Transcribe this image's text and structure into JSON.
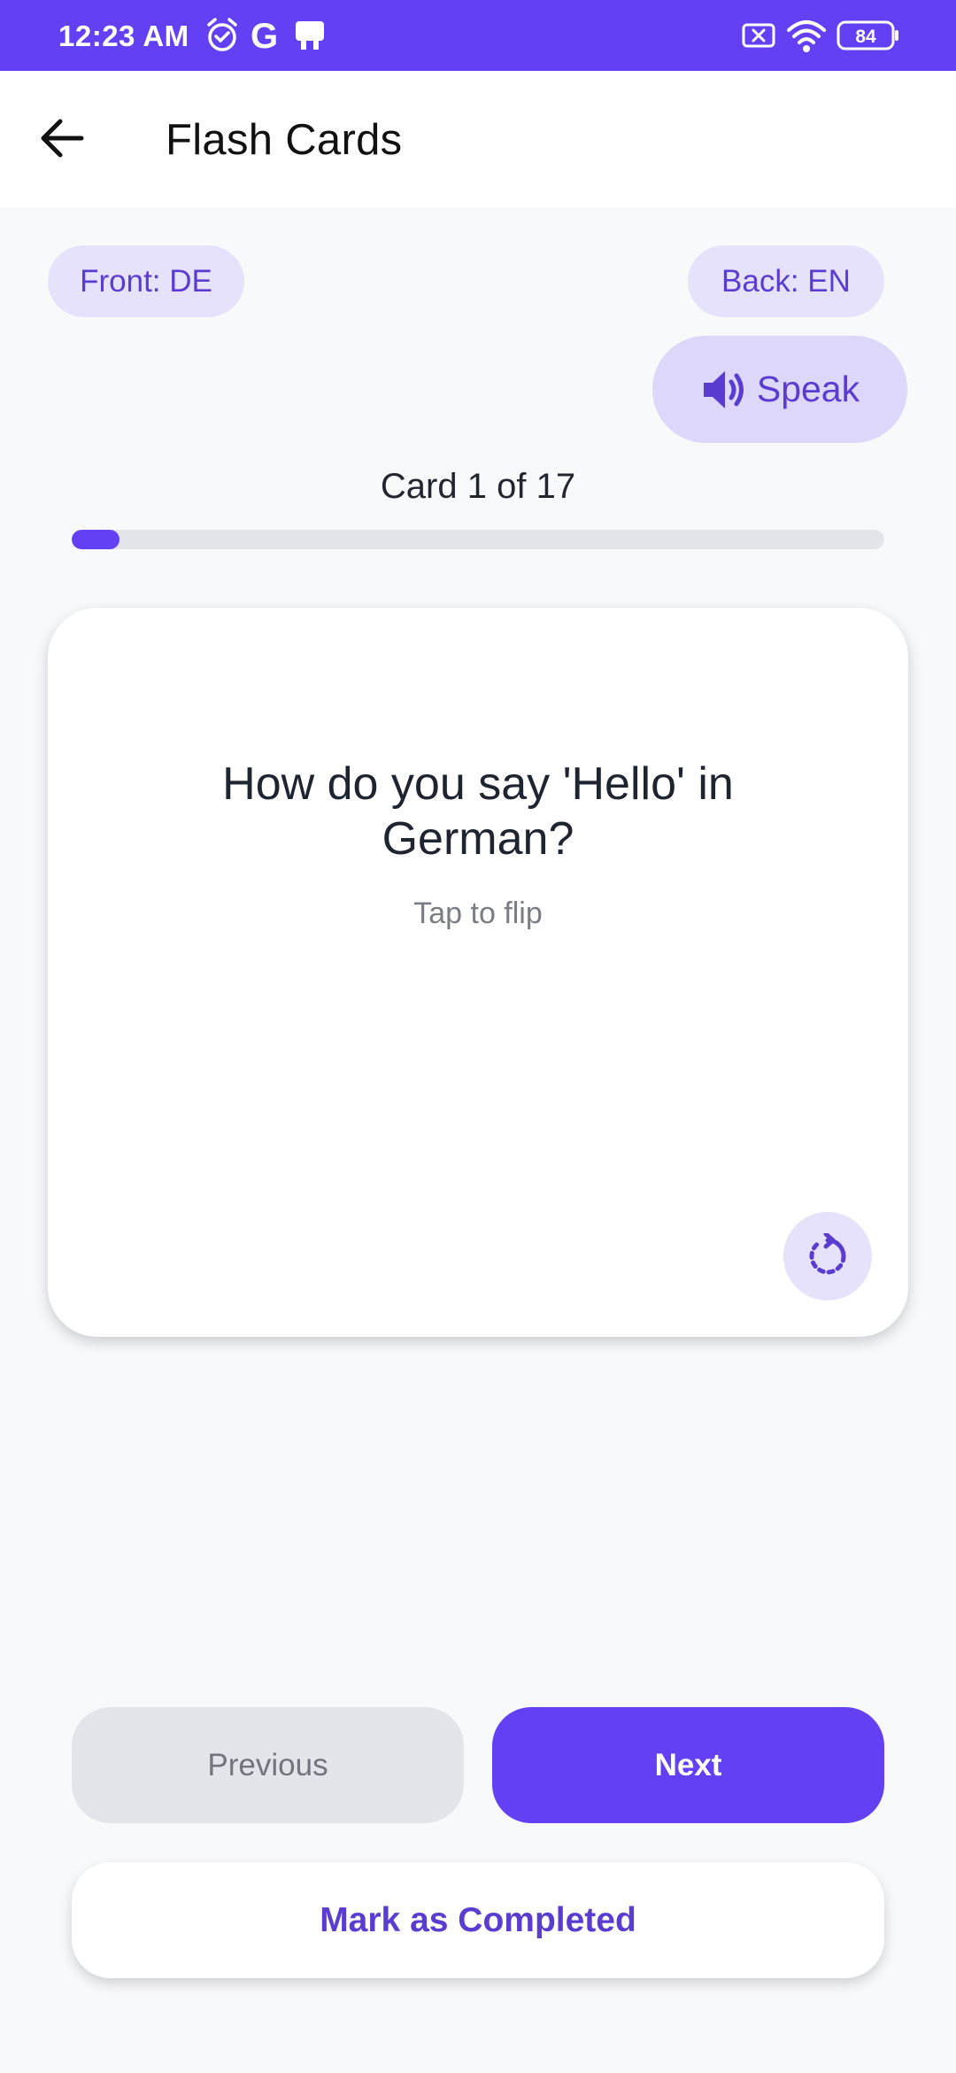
{
  "status_bar": {
    "time": "12:23 AM",
    "battery": "84",
    "left_icons": [
      "alarm-icon",
      "google-icon",
      "notification-app-icon"
    ],
    "right_icons": [
      "no-sim-icon",
      "wifi-icon",
      "battery-icon"
    ]
  },
  "app_bar": {
    "title": "Flash Cards",
    "back_icon": "arrow-left-icon"
  },
  "languages": {
    "front": "Front: DE",
    "back": "Back: EN"
  },
  "speak": {
    "label": "Speak",
    "icon": "speaker-icon"
  },
  "progress": {
    "counter": "Card 1 of 17",
    "fraction": 0.0588
  },
  "card": {
    "question": "How do you say 'Hello' in German?",
    "hint": "Tap to flip",
    "flip_icon": "flip-rotate-icon"
  },
  "actions": {
    "previous": "Previous",
    "next": "Next",
    "complete": "Mark as Completed"
  },
  "colors": {
    "accent": "#6440f5",
    "chip_bg": "#e7e2fb",
    "chip_text": "#5b3cd0",
    "disabled_bg": "#e4e5ea"
  }
}
